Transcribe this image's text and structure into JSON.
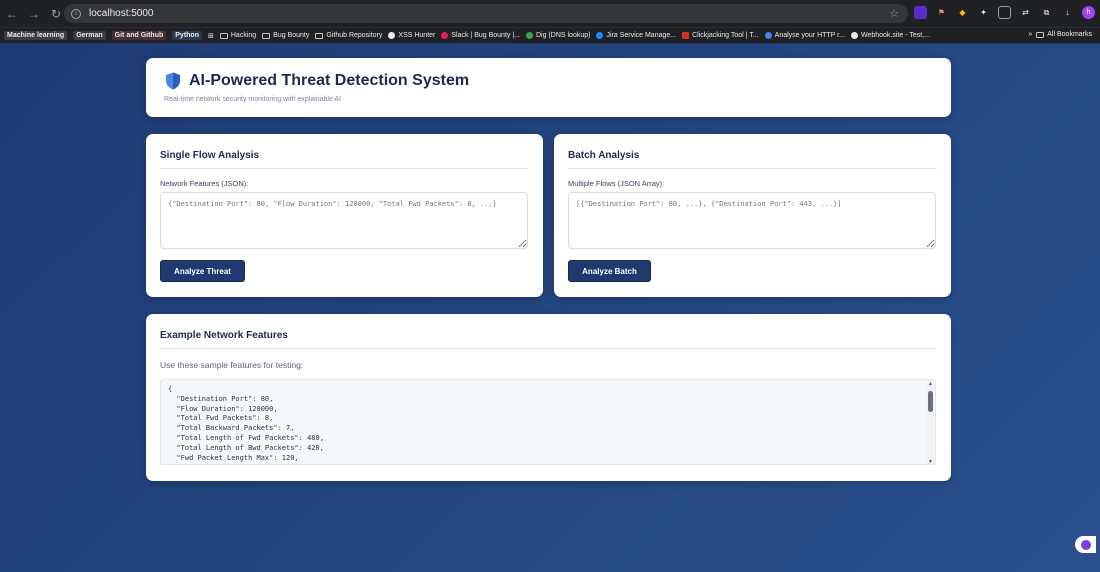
{
  "browser": {
    "url": "localhost:5000",
    "bookmarks": [
      {
        "label": "Machine learning",
        "style": "tag"
      },
      {
        "label": "German",
        "style": "tag"
      },
      {
        "label": "Git and Github",
        "style": "tag-pink"
      },
      {
        "label": "Python",
        "style": "tag-blue"
      },
      {
        "label": "Hacking",
        "style": "folder"
      },
      {
        "label": "Bug Bounty",
        "style": "folder"
      },
      {
        "label": "Github Repository",
        "style": "folder"
      },
      {
        "label": "XSS Hunter",
        "style": "icon"
      },
      {
        "label": "Slack | Bug Bounty |...",
        "style": "icon"
      },
      {
        "label": "Dig (DNS lookup)",
        "style": "icon"
      },
      {
        "label": "Jira Service Manage...",
        "style": "icon"
      },
      {
        "label": "Clickjacking Tool | T...",
        "style": "icon"
      },
      {
        "label": "Analyse your HTTP r...",
        "style": "icon"
      },
      {
        "label": "Webhook.site - Test,...",
        "style": "icon"
      }
    ],
    "all_bookmarks": "All Bookmarks",
    "profile_initial": "h"
  },
  "header": {
    "title": "AI-Powered Threat Detection System",
    "subtitle": "Real-time network security monitoring with explainable AI"
  },
  "single": {
    "title": "Single Flow Analysis",
    "label": "Network Features (JSON):",
    "placeholder": "{\"Destination Port\": 80, \"Flow Duration\": 120000, \"Total Fwd Packets\": 8, ...}",
    "button": "Analyze Threat"
  },
  "batch": {
    "title": "Batch Analysis",
    "label": "Multiple Flows (JSON Array):",
    "placeholder": "[{\"Destination Port\": 80, ...}, {\"Destination Port\": 443, ...}]",
    "button": "Analyze Batch"
  },
  "example": {
    "title": "Example Network Features",
    "description": "Use these sample features for testing:",
    "code_lines": [
      "{",
      "  \"Destination Port\": 80,",
      "  \"Flow Duration\": 120000,",
      "  \"Total Fwd Packets\": 8,",
      "  \"Total Backward Packets\": 7,",
      "  \"Total Length of Fwd Packets\": 480,",
      "  \"Total Length of Bwd Packets\": 420,",
      "  \"Fwd Packet Length Max\": 120,"
    ]
  },
  "colors": {
    "accent": "#1e3a6e",
    "background": "#244781",
    "title": "#1a2b4d"
  }
}
